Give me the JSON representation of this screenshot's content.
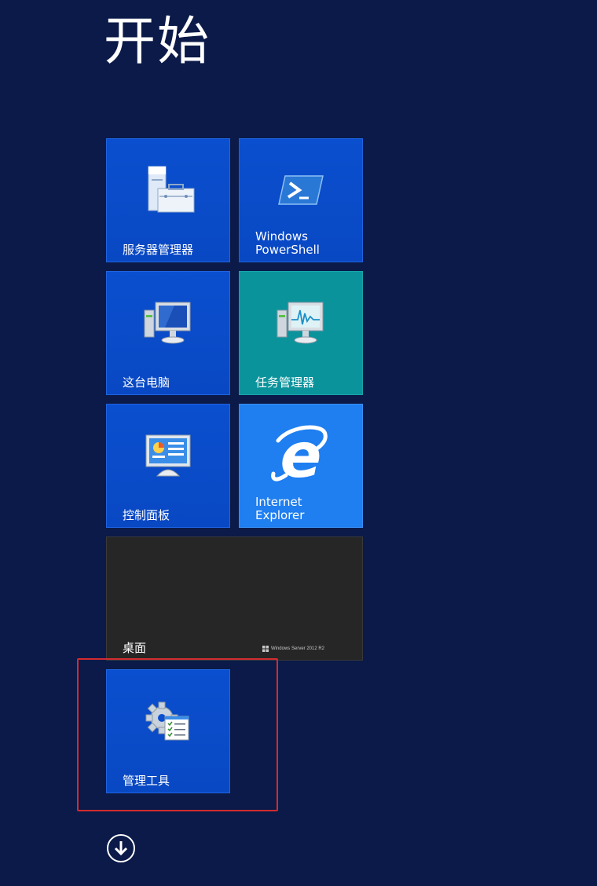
{
  "start": {
    "title": "开始"
  },
  "tiles": {
    "server_manager": {
      "label": "服务器管理器",
      "icon": "server-manager-icon"
    },
    "powershell": {
      "label": "Windows\nPowerShell",
      "icon": "powershell-icon"
    },
    "this_pc": {
      "label": "这台电脑",
      "icon": "computer-icon"
    },
    "task_manager": {
      "label": "任务管理器",
      "icon": "task-manager-icon"
    },
    "control_panel": {
      "label": "控制面板",
      "icon": "control-panel-icon"
    },
    "ie": {
      "label": "Internet\nExplorer",
      "icon": "internet-explorer-icon"
    },
    "desktop": {
      "label": "桌面",
      "brand": "Windows Server 2012 R2"
    },
    "admin_tools": {
      "label": "管理工具",
      "icon": "administrative-tools-icon"
    }
  },
  "navigation": {
    "all_apps_icon": "down-arrow-icon"
  },
  "colors": {
    "background": "#0b1a48",
    "tile_blue": "#0a4fcf",
    "tile_teal": "#0b939c",
    "tile_light_blue": "#1f7ef0",
    "tile_dark": "#262626",
    "highlight": "#d22b30"
  }
}
